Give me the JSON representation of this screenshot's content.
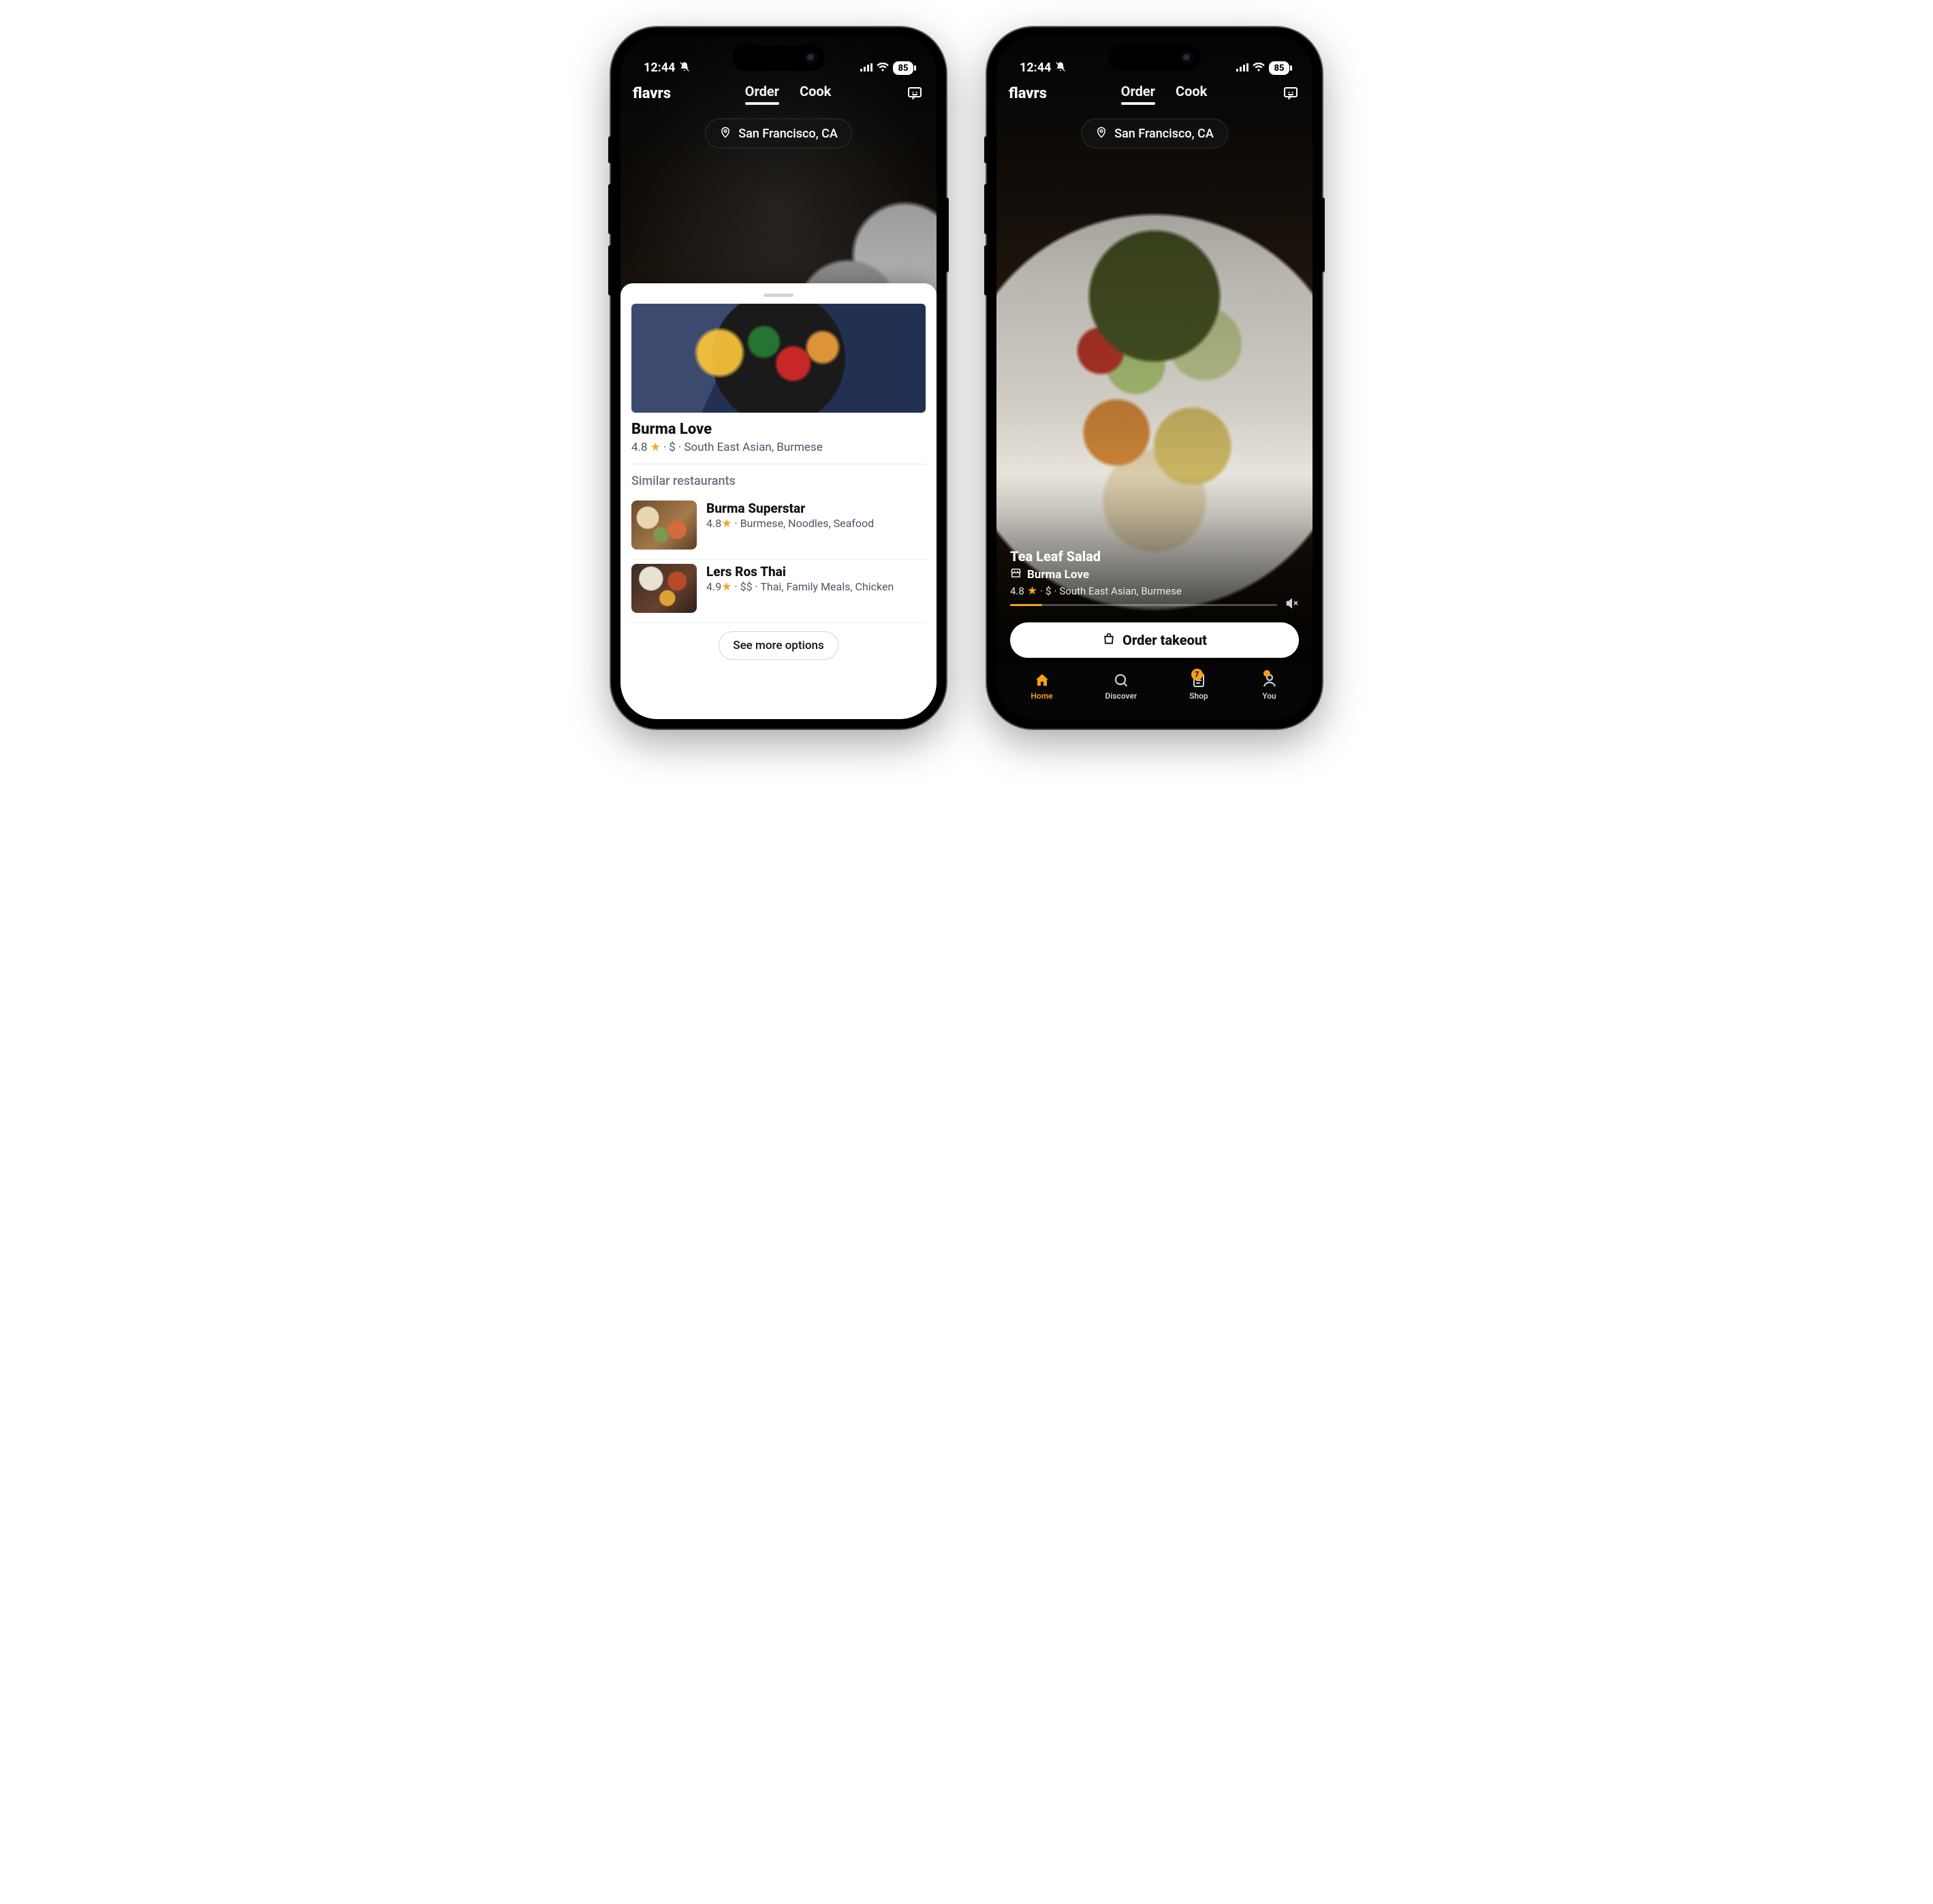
{
  "status": {
    "time": "12:44",
    "battery": "85"
  },
  "app": {
    "brand": "flavrs"
  },
  "tabs": {
    "order": "Order",
    "cook": "Cook",
    "active": "Order"
  },
  "location": {
    "label": "San Francisco, CA"
  },
  "sheet": {
    "restaurant": {
      "name": "Burma Love",
      "rating": "4.8",
      "price": "$",
      "tags": "South East Asian, Burmese"
    },
    "similar_title": "Similar restaurants",
    "similar": [
      {
        "name": "Burma Superstar",
        "rating": "4.8",
        "tags": "Burmese, Noodles, Seafood"
      },
      {
        "name": "Lers Ros Thai",
        "rating": "4.9",
        "tags": "$$ · Thai, Family Meals, Chicken"
      }
    ],
    "see_more": "See more options"
  },
  "dish": {
    "title": "Tea Leaf Salad",
    "restaurant": "Burma Love",
    "rating": "4.8",
    "price": "$",
    "tags": "South East Asian, Burmese"
  },
  "order_btn": "Order takeout",
  "nav": {
    "home": "Home",
    "discover": "Discover",
    "shop": "Shop",
    "shop_badge": "7",
    "you": "You"
  }
}
